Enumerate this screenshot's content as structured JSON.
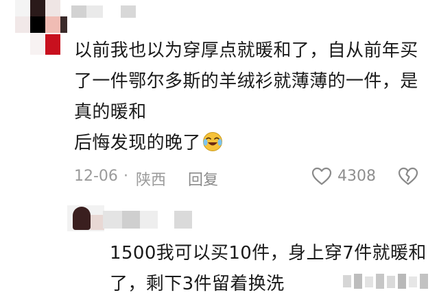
{
  "comment1": {
    "text_lines": [
      "以前我也以为穿厚点就暖和了，自从前年买",
      "了一件鄂尔多斯的羊绒衫就薄薄的一件，是",
      "真的暖和",
      "后悔发现的晚了"
    ],
    "emoji_icon": "laughing-crying-emoji",
    "date": "12-06",
    "separator": "·",
    "location": "陕西",
    "reply_label": "回复",
    "like_count": "4308",
    "like_icon": "heart-outline-icon",
    "dislike_icon": "broken-heart-icon"
  },
  "comment2": {
    "text_lines": [
      "1500我可以买10件，身上穿7件就暖和",
      "了，剩下3件留着换洗"
    ]
  },
  "colors": {
    "text": "#1a1a1a",
    "meta": "#9a9a9a",
    "avatar_red": "#c8101e",
    "avatar_pink": "#f0bcb4",
    "mask_gray": "#dcdcdc"
  }
}
